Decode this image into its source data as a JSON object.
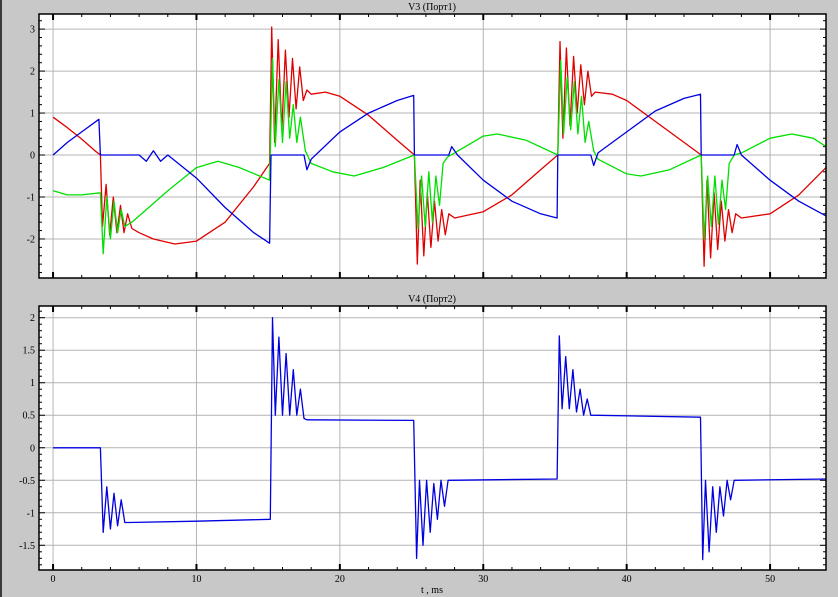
{
  "chart_data": [
    {
      "type": "line",
      "title": "V3 (Порт1)",
      "xlabel": "",
      "ylabel": "",
      "xlim": [
        -0.98,
        53.9
      ],
      "ylim": [
        -2.93,
        3.36
      ],
      "xticks": [
        0,
        10,
        20,
        30,
        40,
        50
      ],
      "xtick_labels_shown": false,
      "yticks": [
        3,
        2,
        1,
        0,
        -1,
        -2
      ],
      "ytick_labels": [
        "3",
        "2",
        "1",
        "0",
        "-1",
        "-2"
      ],
      "grid": true,
      "series": [
        {
          "name": "red",
          "color": "#e00000",
          "points": [
            [
              0,
              0.9
            ],
            [
              1,
              0.65
            ],
            [
              2,
              0.38
            ],
            [
              3,
              0.08
            ],
            [
              3.3,
              0
            ],
            [
              3.45,
              -1.7
            ],
            [
              3.7,
              -0.7
            ],
            [
              3.95,
              -1.9
            ],
            [
              4.2,
              -1.0
            ],
            [
              4.45,
              -1.85
            ],
            [
              4.7,
              -1.2
            ],
            [
              4.95,
              -1.85
            ],
            [
              5.2,
              -1.4
            ],
            [
              5.5,
              -1.75
            ],
            [
              6,
              -1.85
            ],
            [
              7,
              -2.0
            ],
            [
              8.5,
              -2.12
            ],
            [
              10,
              -2.05
            ],
            [
              12,
              -1.6
            ],
            [
              14,
              -0.75
            ],
            [
              15.1,
              -0.2
            ],
            [
              15.25,
              3.05
            ],
            [
              15.45,
              0.3
            ],
            [
              15.7,
              2.75
            ],
            [
              15.95,
              0.6
            ],
            [
              16.2,
              2.5
            ],
            [
              16.45,
              0.9
            ],
            [
              16.7,
              2.3
            ],
            [
              16.95,
              1.1
            ],
            [
              17.2,
              2.1
            ],
            [
              17.45,
              1.3
            ],
            [
              17.7,
              1.55
            ],
            [
              18,
              1.45
            ],
            [
              19,
              1.5
            ],
            [
              20,
              1.4
            ],
            [
              22,
              0.95
            ],
            [
              24,
              0.35
            ],
            [
              25.2,
              0
            ],
            [
              25.4,
              -2.6
            ],
            [
              25.6,
              -0.6
            ],
            [
              25.85,
              -2.4
            ],
            [
              26.1,
              -0.9
            ],
            [
              26.35,
              -2.2
            ],
            [
              26.6,
              -1.1
            ],
            [
              26.85,
              -2.05
            ],
            [
              27.1,
              -1.3
            ],
            [
              27.35,
              -1.9
            ],
            [
              27.6,
              -1.4
            ],
            [
              28,
              -1.5
            ],
            [
              30,
              -1.35
            ],
            [
              32,
              -0.95
            ],
            [
              34,
              -0.35
            ],
            [
              35.2,
              0
            ],
            [
              35.35,
              2.7
            ],
            [
              35.55,
              0.4
            ],
            [
              35.8,
              2.55
            ],
            [
              36.05,
              0.7
            ],
            [
              36.3,
              2.35
            ],
            [
              36.55,
              1.0
            ],
            [
              36.8,
              2.15
            ],
            [
              37.05,
              1.2
            ],
            [
              37.3,
              2.0
            ],
            [
              37.55,
              1.4
            ],
            [
              37.8,
              1.5
            ],
            [
              39,
              1.45
            ],
            [
              40,
              1.3
            ],
            [
              42,
              0.8
            ],
            [
              44,
              0.3
            ],
            [
              45.2,
              0
            ],
            [
              45.4,
              -2.65
            ],
            [
              45.6,
              -0.6
            ],
            [
              45.85,
              -2.45
            ],
            [
              46.1,
              -0.9
            ],
            [
              46.35,
              -2.25
            ],
            [
              46.6,
              -1.1
            ],
            [
              46.85,
              -2.05
            ],
            [
              47.1,
              -1.3
            ],
            [
              47.35,
              -1.85
            ],
            [
              47.6,
              -1.4
            ],
            [
              48,
              -1.5
            ],
            [
              50,
              -1.4
            ],
            [
              52,
              -0.95
            ],
            [
              53.9,
              -0.3
            ]
          ]
        },
        {
          "name": "green",
          "color": "#00e000",
          "points": [
            [
              0,
              -0.85
            ],
            [
              1,
              -0.95
            ],
            [
              2,
              -0.95
            ],
            [
              3.3,
              -0.9
            ],
            [
              3.5,
              -2.35
            ],
            [
              3.75,
              -1.0
            ],
            [
              4.0,
              -2.0
            ],
            [
              4.25,
              -1.1
            ],
            [
              4.5,
              -1.85
            ],
            [
              4.75,
              -1.3
            ],
            [
              5.0,
              -1.7
            ],
            [
              5.5,
              -1.6
            ],
            [
              6.5,
              -1.3
            ],
            [
              8,
              -0.85
            ],
            [
              10,
              -0.3
            ],
            [
              11.5,
              -0.15
            ],
            [
              13,
              -0.3
            ],
            [
              15.1,
              -0.6
            ],
            [
              15.3,
              2.3
            ],
            [
              15.5,
              0.2
            ],
            [
              15.75,
              1.8
            ],
            [
              16.0,
              0.3
            ],
            [
              16.25,
              1.75
            ],
            [
              16.5,
              0.4
            ],
            [
              16.75,
              1.2
            ],
            [
              17.0,
              0.3
            ],
            [
              17.25,
              0.9
            ],
            [
              17.6,
              0.1
            ],
            [
              18,
              -0.2
            ],
            [
              19.5,
              -0.4
            ],
            [
              21,
              -0.5
            ],
            [
              23,
              -0.3
            ],
            [
              25.2,
              0
            ],
            [
              25.45,
              -1.75
            ],
            [
              25.7,
              -0.5
            ],
            [
              25.95,
              -1.7
            ],
            [
              26.2,
              -0.4
            ],
            [
              26.45,
              -1.6
            ],
            [
              26.7,
              -0.5
            ],
            [
              26.95,
              -1.2
            ],
            [
              27.2,
              -0.2
            ],
            [
              27.5,
              -0.05
            ],
            [
              28,
              0.05
            ],
            [
              30,
              0.45
            ],
            [
              31,
              0.5
            ],
            [
              33,
              0.35
            ],
            [
              35.2,
              0
            ],
            [
              35.4,
              2.25
            ],
            [
              35.6,
              0.5
            ],
            [
              35.85,
              1.85
            ],
            [
              36.1,
              0.6
            ],
            [
              36.35,
              1.75
            ],
            [
              36.6,
              0.5
            ],
            [
              36.85,
              1.4
            ],
            [
              37.1,
              0.3
            ],
            [
              37.35,
              0.8
            ],
            [
              37.7,
              0.1
            ],
            [
              38,
              -0.1
            ],
            [
              40,
              -0.45
            ],
            [
              41,
              -0.5
            ],
            [
              43,
              -0.35
            ],
            [
              45.2,
              0
            ],
            [
              45.4,
              -2.0
            ],
            [
              45.65,
              -0.5
            ],
            [
              45.9,
              -1.7
            ],
            [
              46.15,
              -0.5
            ],
            [
              46.4,
              -1.65
            ],
            [
              46.65,
              -0.6
            ],
            [
              46.9,
              -1.3
            ],
            [
              47.15,
              -0.2
            ],
            [
              47.5,
              0
            ],
            [
              48,
              0.05
            ],
            [
              50,
              0.4
            ],
            [
              51.5,
              0.5
            ],
            [
              53,
              0.4
            ],
            [
              53.9,
              0.2
            ]
          ]
        },
        {
          "name": "blue",
          "color": "#0000e0",
          "points": [
            [
              0,
              0
            ],
            [
              1,
              0.3
            ],
            [
              2,
              0.55
            ],
            [
              3.2,
              0.85
            ],
            [
              3.3,
              0
            ],
            [
              6,
              0
            ],
            [
              6.5,
              -0.15
            ],
            [
              7,
              0.1
            ],
            [
              7.5,
              -0.15
            ],
            [
              8,
              0
            ],
            [
              10,
              -0.55
            ],
            [
              12,
              -1.25
            ],
            [
              14,
              -1.85
            ],
            [
              15.1,
              -2.1
            ],
            [
              15.2,
              0
            ],
            [
              17.5,
              0
            ],
            [
              17.7,
              -0.35
            ],
            [
              18,
              -0.1
            ],
            [
              20,
              0.55
            ],
            [
              22,
              1.0
            ],
            [
              24,
              1.3
            ],
            [
              25.15,
              1.42
            ],
            [
              25.2,
              0
            ],
            [
              27.6,
              0
            ],
            [
              27.8,
              0.2
            ],
            [
              28.2,
              0
            ],
            [
              30,
              -0.6
            ],
            [
              32,
              -1.1
            ],
            [
              34,
              -1.4
            ],
            [
              35.15,
              -1.5
            ],
            [
              35.2,
              0
            ],
            [
              37.5,
              0
            ],
            [
              37.7,
              -0.25
            ],
            [
              38,
              0.05
            ],
            [
              40,
              0.55
            ],
            [
              42,
              1.05
            ],
            [
              44,
              1.35
            ],
            [
              45.15,
              1.45
            ],
            [
              45.2,
              0
            ],
            [
              47.5,
              0
            ],
            [
              47.7,
              0.25
            ],
            [
              48,
              0
            ],
            [
              50,
              -0.6
            ],
            [
              52,
              -1.1
            ],
            [
              53.9,
              -1.45
            ]
          ]
        }
      ]
    },
    {
      "type": "line",
      "title": "V4 (Порт2)",
      "xlabel": "t , ms",
      "ylabel": "",
      "xlim": [
        -0.98,
        53.9
      ],
      "ylim": [
        -1.88,
        2.18
      ],
      "xticks": [
        0,
        10,
        20,
        30,
        40,
        50
      ],
      "xtick_labels": [
        "0",
        "10",
        "20",
        "30",
        "40",
        "50"
      ],
      "yticks": [
        2,
        1.5,
        1,
        0.5,
        0,
        -0.5,
        -1,
        -1.5
      ],
      "ytick_labels": [
        "2",
        "1.5",
        "1",
        "0.5",
        "0",
        "-0.5",
        "-1",
        "-1.5"
      ],
      "grid": true,
      "series": [
        {
          "name": "V4",
          "color": "#0000e0",
          "points": [
            [
              0,
              0
            ],
            [
              3.3,
              0
            ],
            [
              3.5,
              -1.3
            ],
            [
              3.75,
              -0.6
            ],
            [
              4.0,
              -1.25
            ],
            [
              4.25,
              -0.7
            ],
            [
              4.5,
              -1.2
            ],
            [
              4.75,
              -0.8
            ],
            [
              5.0,
              -1.15
            ],
            [
              5.3,
              -1.15
            ],
            [
              10,
              -1.13
            ],
            [
              15.15,
              -1.1
            ],
            [
              15.3,
              2.0
            ],
            [
              15.5,
              0.5
            ],
            [
              15.75,
              1.7
            ],
            [
              16.0,
              0.5
            ],
            [
              16.25,
              1.45
            ],
            [
              16.5,
              0.5
            ],
            [
              16.75,
              1.2
            ],
            [
              17.0,
              0.5
            ],
            [
              17.25,
              0.9
            ],
            [
              17.5,
              0.45
            ],
            [
              17.7,
              0.43
            ],
            [
              25.15,
              0.42
            ],
            [
              25.35,
              -1.7
            ],
            [
              25.55,
              -0.5
            ],
            [
              25.8,
              -1.5
            ],
            [
              26.05,
              -0.5
            ],
            [
              26.3,
              -1.3
            ],
            [
              26.55,
              -0.55
            ],
            [
              26.8,
              -1.1
            ],
            [
              27.05,
              -0.5
            ],
            [
              27.3,
              -0.9
            ],
            [
              27.55,
              -0.5
            ],
            [
              35.15,
              -0.48
            ],
            [
              35.3,
              1.72
            ],
            [
              35.5,
              0.6
            ],
            [
              35.75,
              1.4
            ],
            [
              36.0,
              0.6
            ],
            [
              36.25,
              1.2
            ],
            [
              36.5,
              0.55
            ],
            [
              36.75,
              0.9
            ],
            [
              37.0,
              0.5
            ],
            [
              37.25,
              0.75
            ],
            [
              37.5,
              0.5
            ],
            [
              45.15,
              0.47
            ],
            [
              45.3,
              -1.72
            ],
            [
              45.5,
              -0.5
            ],
            [
              45.75,
              -1.6
            ],
            [
              46.0,
              -0.6
            ],
            [
              46.25,
              -1.3
            ],
            [
              46.5,
              -0.6
            ],
            [
              46.75,
              -1.05
            ],
            [
              47.0,
              -0.5
            ],
            [
              47.25,
              -0.8
            ],
            [
              47.5,
              -0.5
            ],
            [
              53.9,
              -0.48
            ]
          ]
        }
      ]
    }
  ]
}
